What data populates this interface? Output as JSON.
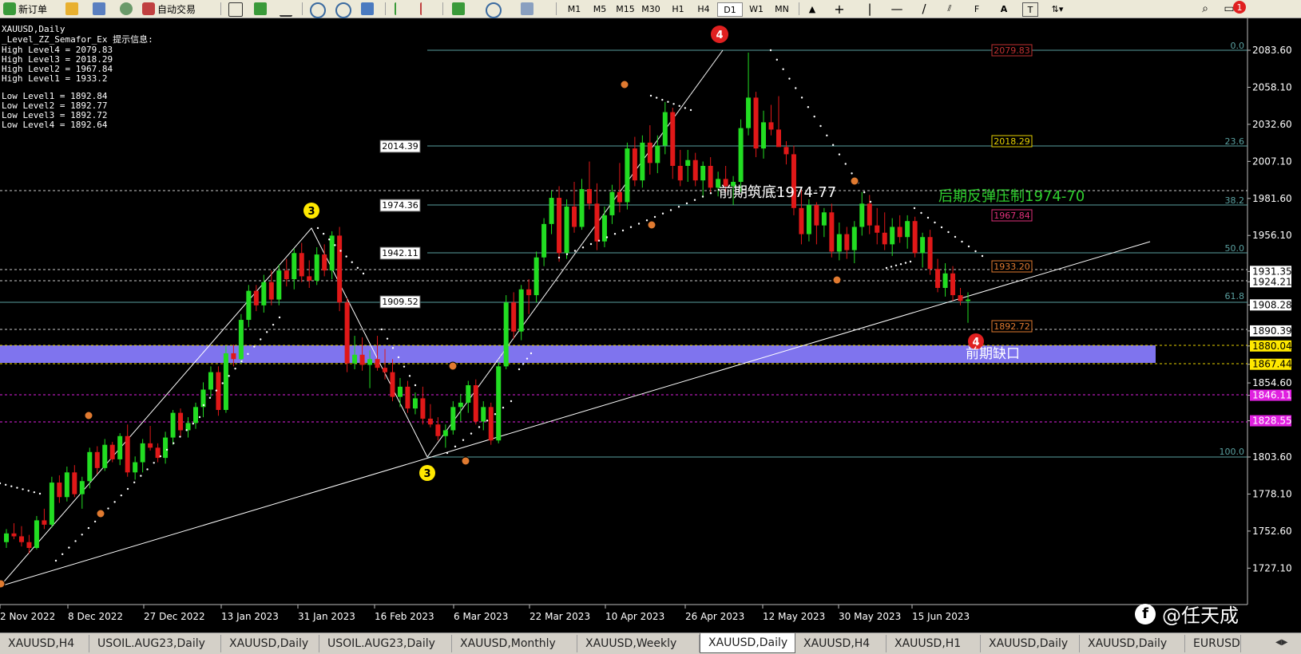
{
  "toolbar": {
    "new_order": "新订单",
    "auto_trading": "自动交易",
    "timeframes": [
      "M1",
      "M5",
      "M15",
      "M30",
      "H1",
      "H4",
      "D1",
      "W1",
      "MN"
    ],
    "notification_count": "1"
  },
  "chart": {
    "symbol_title": "XAUUSD,Daily",
    "indicator_info": {
      "title": "_Level_ZZ_Semafor_Ex 提示信息:",
      "lines": [
        "High Level4 = 2079.83",
        "High Level3 = 2018.29",
        "High Level2 = 1967.84",
        "High Level1 = 1933.2",
        "",
        "Low Level1 = 1892.84",
        "Low Level2 = 1892.77",
        "Low Level3 = 1892.72",
        "Low Level4 = 1892.64"
      ]
    },
    "price_axis": [
      "2083.60",
      "2058.10",
      "2032.60",
      "2007.10",
      "1981.60",
      "1956.10",
      "1931.35",
      "1924.21",
      "1908.28",
      "1890.39",
      "1880.04",
      "1867.44",
      "1854.60",
      "1846.11",
      "1828.55",
      "1803.60",
      "1778.10",
      "1752.60",
      "1727.10"
    ],
    "date_axis": [
      "2 Nov 2022",
      "8 Dec 2022",
      "27 Dec 2022",
      "13 Jan 2023",
      "31 Jan 2023",
      "16 Feb 2023",
      "6 Mar 2023",
      "22 Mar 2023",
      "10 Apr 2023",
      "26 Apr 2023",
      "12 May 2023",
      "30 May 2023",
      "15 Jun 2023"
    ],
    "fib_ratios": [
      "0.0",
      "23.6",
      "38.2",
      "50.0",
      "61.8",
      "100.0"
    ],
    "fib_prices": [
      "2014.39",
      "1974.36",
      "1942.11",
      "1909.52"
    ],
    "level_labels": [
      "2079.83",
      "2018.29",
      "1967.84",
      "1933.20",
      "1892.72"
    ],
    "annotations": {
      "prior_bottom": "前期筑底1974-77",
      "later_resistance": "后期反弹压制1974-70",
      "prior_gap": "前期缺口"
    },
    "semafor_marks": [
      "4",
      "3",
      "3",
      "4"
    ],
    "watermark": "@任天成"
  },
  "tabs": [
    "XAUUSD,H4",
    "USOIL.AUG23,Daily",
    "XAUUSD,Daily",
    "USOIL.AUG23,Daily",
    "XAUUSD,Monthly",
    "XAUUSD,Weekly",
    "XAUUSD,Daily",
    "XAUUSD,H4",
    "XAUUSD,H1",
    "XAUUSD,Daily",
    "XAUUSD,Daily",
    "EURUSD,Da"
  ],
  "active_tab_index": 6,
  "candles": [
    [
      1745,
      1754,
      1741,
      1751
    ],
    [
      1751,
      1758,
      1747,
      1749
    ],
    [
      1749,
      1756,
      1742,
      1745
    ],
    [
      1745,
      1750,
      1737,
      1741
    ],
    [
      1741,
      1763,
      1740,
      1760
    ],
    [
      1760,
      1768,
      1754,
      1757
    ],
    [
      1757,
      1790,
      1755,
      1786
    ],
    [
      1786,
      1791,
      1772,
      1776
    ],
    [
      1776,
      1797,
      1773,
      1793
    ],
    [
      1793,
      1798,
      1776,
      1778
    ],
    [
      1778,
      1790,
      1768,
      1787
    ],
    [
      1787,
      1810,
      1782,
      1807
    ],
    [
      1807,
      1811,
      1792,
      1796
    ],
    [
      1796,
      1816,
      1794,
      1812
    ],
    [
      1812,
      1814,
      1800,
      1802
    ],
    [
      1802,
      1820,
      1798,
      1818
    ],
    [
      1818,
      1826,
      1790,
      1793
    ],
    [
      1793,
      1804,
      1788,
      1800
    ],
    [
      1800,
      1816,
      1793,
      1813
    ],
    [
      1813,
      1825,
      1808,
      1810
    ],
    [
      1810,
      1813,
      1800,
      1803
    ],
    [
      1803,
      1821,
      1799,
      1817
    ],
    [
      1817,
      1836,
      1812,
      1834
    ],
    [
      1834,
      1837,
      1818,
      1822
    ],
    [
      1822,
      1831,
      1817,
      1827
    ],
    [
      1827,
      1841,
      1823,
      1838
    ],
    [
      1838,
      1855,
      1831,
      1850
    ],
    [
      1850,
      1866,
      1845,
      1862
    ],
    [
      1862,
      1866,
      1832,
      1836
    ],
    [
      1836,
      1880,
      1834,
      1875
    ],
    [
      1875,
      1881,
      1866,
      1871
    ],
    [
      1871,
      1902,
      1868,
      1898
    ],
    [
      1898,
      1922,
      1893,
      1918
    ],
    [
      1918,
      1922,
      1904,
      1908
    ],
    [
      1908,
      1929,
      1903,
      1924
    ],
    [
      1924,
      1932,
      1908,
      1912
    ],
    [
      1912,
      1936,
      1908,
      1932
    ],
    [
      1932,
      1940,
      1921,
      1926
    ],
    [
      1926,
      1947,
      1919,
      1944
    ],
    [
      1944,
      1951,
      1924,
      1928
    ],
    [
      1928,
      1939,
      1920,
      1925
    ],
    [
      1925,
      1948,
      1922,
      1943
    ],
    [
      1943,
      1950,
      1928,
      1932
    ],
    [
      1932,
      1959,
      1926,
      1956
    ],
    [
      1956,
      1962,
      1904,
      1910
    ],
    [
      1910,
      1913,
      1862,
      1868
    ],
    [
      1868,
      1887,
      1864,
      1874
    ],
    [
      1874,
      1886,
      1863,
      1867
    ],
    [
      1867,
      1877,
      1851,
      1871
    ],
    [
      1871,
      1887,
      1863,
      1865
    ],
    [
      1865,
      1878,
      1857,
      1862
    ],
    [
      1862,
      1871,
      1842,
      1845
    ],
    [
      1845,
      1858,
      1838,
      1852
    ],
    [
      1852,
      1856,
      1834,
      1837
    ],
    [
      1837,
      1848,
      1833,
      1844
    ],
    [
      1844,
      1852,
      1826,
      1830
    ],
    [
      1830,
      1840,
      1824,
      1826
    ],
    [
      1826,
      1831,
      1815,
      1818
    ],
    [
      1818,
      1826,
      1810,
      1822
    ],
    [
      1822,
      1842,
      1819,
      1838
    ],
    [
      1838,
      1847,
      1828,
      1841
    ],
    [
      1841,
      1856,
      1834,
      1853
    ],
    [
      1853,
      1857,
      1826,
      1828
    ],
    [
      1828,
      1842,
      1822,
      1838
    ],
    [
      1838,
      1841,
      1812,
      1815
    ],
    [
      1815,
      1869,
      1813,
      1866
    ],
    [
      1866,
      1915,
      1864,
      1910
    ],
    [
      1910,
      1917,
      1885,
      1890
    ],
    [
      1890,
      1922,
      1884,
      1919
    ],
    [
      1919,
      1926,
      1902,
      1915
    ],
    [
      1915,
      1945,
      1910,
      1941
    ],
    [
      1941,
      1968,
      1935,
      1964
    ],
    [
      1964,
      1987,
      1957,
      1982
    ],
    [
      1982,
      1990,
      1938,
      1944
    ],
    [
      1944,
      1981,
      1940,
      1976
    ],
    [
      1976,
      1993,
      1958,
      1962
    ],
    [
      1962,
      1995,
      1960,
      1988
    ],
    [
      1988,
      2007,
      1974,
      1978
    ],
    [
      1978,
      1992,
      1946,
      1952
    ],
    [
      1952,
      1976,
      1948,
      1970
    ],
    [
      1970,
      1991,
      1964,
      1986
    ],
    [
      1986,
      2006,
      1972,
      1979
    ],
    [
      1979,
      2020,
      1974,
      2016
    ],
    [
      2016,
      2024,
      1990,
      1994
    ],
    [
      1994,
      2025,
      1989,
      2020
    ],
    [
      2020,
      2032,
      1998,
      2006
    ],
    [
      2006,
      2025,
      1999,
      2018
    ],
    [
      2018,
      2048,
      2012,
      2041
    ],
    [
      2041,
      2044,
      1995,
      2004
    ],
    [
      2004,
      2015,
      1990,
      1994
    ],
    [
      2004,
      2015,
      1993,
      2008
    ],
    [
      2008,
      2013,
      1990,
      1994
    ],
    [
      1994,
      2007,
      1982,
      2004
    ],
    [
      2004,
      2010,
      1985,
      1989
    ],
    [
      1989,
      2000,
      1983,
      1995
    ],
    [
      1995,
      2004,
      1986,
      1990
    ],
    [
      1990,
      1997,
      1977,
      1993
    ],
    [
      1993,
      2036,
      1986,
      2030
    ],
    [
      2030,
      2082,
      2025,
      2051
    ],
    [
      2051,
      2055,
      2010,
      2016
    ],
    [
      2016,
      2042,
      2009,
      2034
    ],
    [
      2034,
      2046,
      2025,
      2029
    ],
    [
      2029,
      2052,
      2023,
      2017
    ],
    [
      2017,
      2021,
      2005,
      2012
    ],
    [
      2012,
      2018,
      1970,
      1975
    ],
    [
      1975,
      1988,
      1950,
      1957
    ],
    [
      1957,
      1981,
      1952,
      1977
    ],
    [
      1977,
      1979,
      1950,
      1963
    ],
    [
      1963,
      1975,
      1955,
      1972
    ],
    [
      1972,
      1978,
      1941,
      1945
    ],
    [
      1945,
      1965,
      1939,
      1957
    ],
    [
      1957,
      1962,
      1940,
      1946
    ],
    [
      1946,
      1966,
      1937,
      1962
    ],
    [
      1962,
      1986,
      1956,
      1978
    ],
    [
      1978,
      1984,
      1957,
      1963
    ],
    [
      1963,
      1975,
      1950,
      1958
    ],
    [
      1958,
      1972,
      1946,
      1950
    ],
    [
      1950,
      1968,
      1942,
      1962
    ],
    [
      1962,
      1970,
      1951,
      1955
    ],
    [
      1955,
      1970,
      1947,
      1966
    ],
    [
      1966,
      1969,
      1941,
      1944
    ],
    [
      1944,
      1958,
      1934,
      1955
    ],
    [
      1955,
      1960,
      1929,
      1933
    ],
    [
      1933,
      1940,
      1917,
      1920
    ],
    [
      1920,
      1937,
      1914,
      1930
    ],
    [
      1930,
      1935,
      1911,
      1915
    ],
    [
      1915,
      1920,
      1908,
      1911
    ],
    [
      1911,
      1917,
      1896,
      1912
    ]
  ]
}
